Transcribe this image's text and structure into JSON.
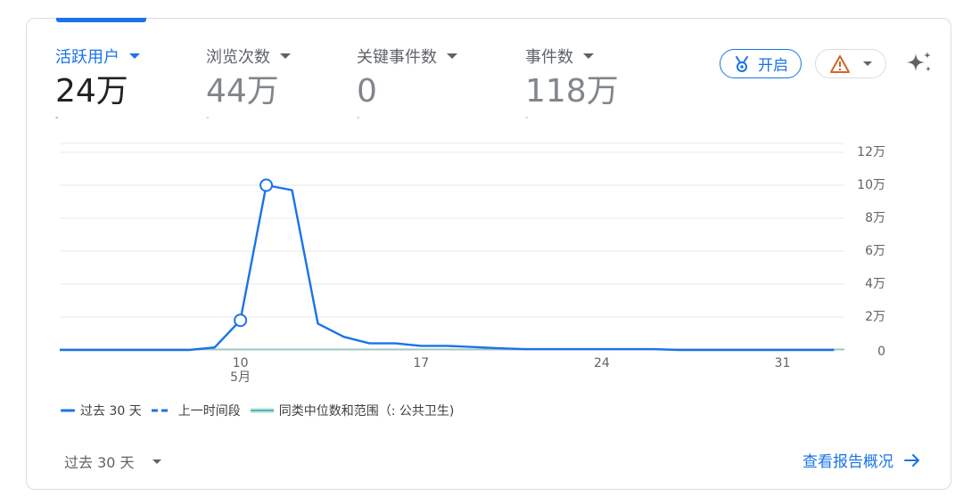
{
  "metrics": [
    {
      "label": "活跃用户",
      "value": "24万",
      "delta": "-"
    },
    {
      "label": "浏览次数",
      "value": "44万",
      "delta": "-"
    },
    {
      "label": "关键事件数",
      "value": "0",
      "delta": "-"
    },
    {
      "label": "事件数",
      "value": "118万",
      "delta": "-"
    }
  ],
  "toolbar": {
    "open_label": "开启",
    "icons": [
      "medal-icon",
      "warning-icon",
      "chevron-down-icon",
      "sparkle-icon"
    ]
  },
  "colors": {
    "accent": "#1a73e8",
    "warning": "#d4652a",
    "benchmark": "#80cbc4"
  },
  "chart_data": {
    "type": "line",
    "x_ticks": [
      {
        "day": 10,
        "label": "10",
        "sublabel": "5月"
      },
      {
        "day": 17,
        "label": "17",
        "sublabel": ""
      },
      {
        "day": 24,
        "label": "24",
        "sublabel": ""
      },
      {
        "day": 31,
        "label": "31",
        "sublabel": ""
      }
    ],
    "y_ticks": [
      "0",
      "2万",
      "4万",
      "6万",
      "8万",
      "10万",
      "12万"
    ],
    "ylim": [
      0,
      120000
    ],
    "xlim": [
      3,
      33.4
    ],
    "series": [
      {
        "name": "过去 30 天",
        "style": "solid",
        "x": [
          3,
          4,
          5,
          6,
          7,
          8,
          9,
          10,
          11,
          12,
          13,
          14,
          15,
          16,
          17,
          18,
          19,
          20,
          21,
          22,
          23,
          24,
          25,
          26,
          27,
          28,
          29,
          30,
          31,
          32,
          33
        ],
        "values": [
          0,
          0,
          0,
          0,
          0,
          0,
          1500,
          18000,
          100000,
          97000,
          16000,
          8000,
          4000,
          4000,
          2500,
          2500,
          1800,
          1000,
          500,
          500,
          500,
          500,
          500,
          500,
          0,
          0,
          0,
          0,
          0,
          0,
          0
        ],
        "markers": [
          10,
          11
        ]
      }
    ],
    "legend": [
      {
        "label": "过去 30 天",
        "style": "solid"
      },
      {
        "label": "上一时间段",
        "style": "dashed"
      },
      {
        "label": "同类中位数和范围（: 公共卫生)",
        "style": "band"
      }
    ],
    "legend_position": "bottom-left",
    "grid": true
  },
  "footer": {
    "range_label": "过去 30 天",
    "report_link": "查看报告概况"
  }
}
